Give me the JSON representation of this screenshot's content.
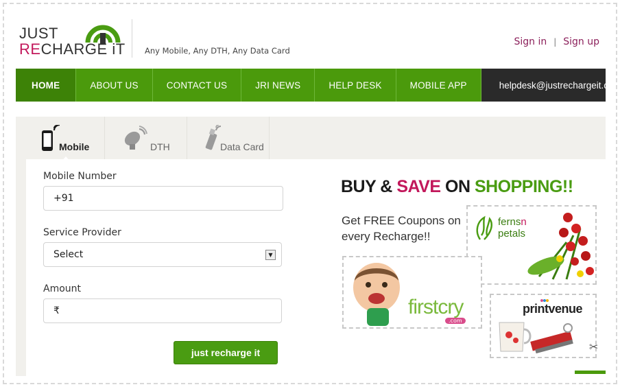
{
  "header": {
    "logo_line1": "JUST",
    "logo_re": "RE",
    "logo_rest": "CHARGE",
    "logo_it": "iT",
    "tagline": "Any Mobile, Any DTH, Any Data Card",
    "sign_in": "Sign in",
    "separator": "|",
    "sign_up": "Sign up"
  },
  "nav": {
    "items": [
      {
        "label": "HOME"
      },
      {
        "label": "ABOUT US"
      },
      {
        "label": "CONTACT US"
      },
      {
        "label": "JRI NEWS"
      },
      {
        "label": "HELP DESK"
      },
      {
        "label": "MOBILE APP"
      }
    ],
    "email": "helpdesk@justrechargeit.co"
  },
  "tabs": [
    {
      "label": "Mobile",
      "icon": "mobile-phone-icon"
    },
    {
      "label": "DTH",
      "icon": "satellite-dish-icon"
    },
    {
      "label": "Data Card",
      "icon": "usb-data-card-icon"
    }
  ],
  "form": {
    "mobile_label": "Mobile Number",
    "mobile_value": "+91",
    "provider_label": "Service Provider",
    "provider_value": "Select",
    "amount_label": "Amount",
    "amount_value": "₹",
    "submit_label": "just recharge it"
  },
  "promo": {
    "title_buy": "BUY",
    "title_amp": "&",
    "title_save": "SAVE",
    "title_on": "ON",
    "title_shopping": "SHOPPING!!",
    "subtitle": "Get FREE Coupons on every Recharge!!",
    "partners": [
      {
        "name_1": "ferns",
        "name_n": "n",
        "name_2": "petals"
      },
      {
        "name": "firstcry",
        "suffix": ".com"
      },
      {
        "name": "printvenue"
      }
    ]
  },
  "colors": {
    "brand_green": "#4b9a0c",
    "brand_pink": "#c2185b",
    "dark": "#2a2a2a"
  }
}
